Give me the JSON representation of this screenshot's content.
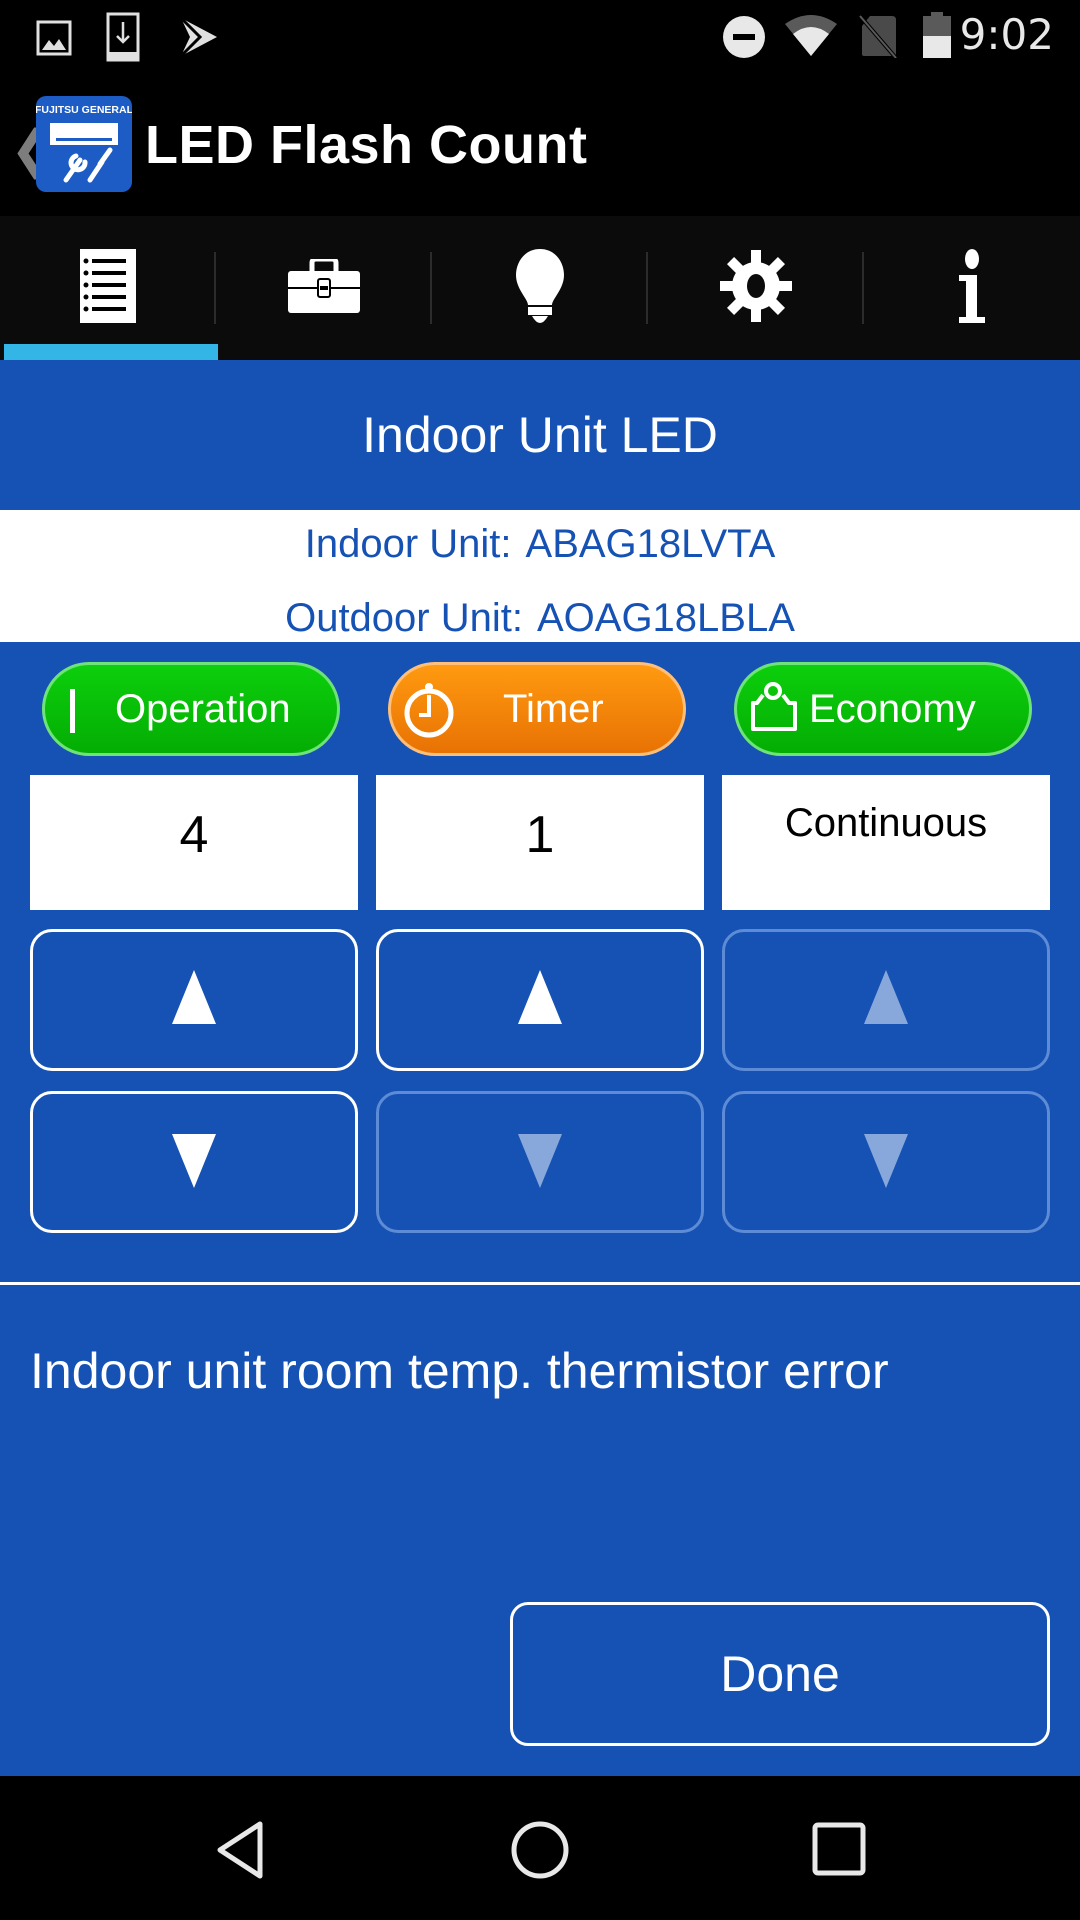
{
  "status_bar": {
    "time": "9:02",
    "left_icons": [
      "gallery-icon",
      "download-icon",
      "play-store-icon"
    ],
    "right_icons": [
      "do-not-disturb-icon",
      "wifi-icon",
      "no-sim-icon",
      "battery-icon"
    ]
  },
  "app_bar": {
    "back_glyph": "❮",
    "logo_brand": "FUJITSU GENERAL",
    "title": "LED Flash Count"
  },
  "tabs": [
    {
      "name": "checklist",
      "icon": "checklist-icon",
      "active": true
    },
    {
      "name": "toolbox",
      "icon": "toolbox-icon",
      "active": false
    },
    {
      "name": "lightbulb",
      "icon": "lightbulb-icon",
      "active": false
    },
    {
      "name": "settings",
      "icon": "gear-icon",
      "active": false
    },
    {
      "name": "info",
      "icon": "info-icon",
      "active": false
    }
  ],
  "banner": {
    "title": "Indoor Unit LED"
  },
  "units": {
    "indoor_label": "Indoor Unit:",
    "indoor_model": "ABAG18LVTA",
    "outdoor_label": "Outdoor Unit:",
    "outdoor_model": "AOAG18LBLA"
  },
  "indicators": [
    {
      "label": "Operation",
      "color": "#0bc40b",
      "icon": "operation-bar-icon",
      "value": "4",
      "up_enabled": true,
      "down_enabled": true
    },
    {
      "label": "Timer",
      "color": "#f58a0a",
      "icon": "timer-icon",
      "value": "1",
      "up_enabled": true,
      "down_enabled": false
    },
    {
      "label": "Economy",
      "color": "#0bc40b",
      "icon": "economy-icon",
      "value": "Continuous",
      "up_enabled": false,
      "down_enabled": false
    }
  ],
  "stepper": {
    "up_glyph": "▲",
    "down_glyph": "▼"
  },
  "error_message": "Indoor unit room temp. thermistor error",
  "done_label": "Done",
  "colors": {
    "primary_blue": "#1552b3",
    "tab_indicator": "#33b5e5",
    "operation_green": "#0bc40b",
    "timer_orange": "#f58a0a",
    "disabled_outline": "#5e8bd5"
  },
  "nav_bar": [
    "back-icon",
    "home-icon",
    "recents-icon"
  ]
}
